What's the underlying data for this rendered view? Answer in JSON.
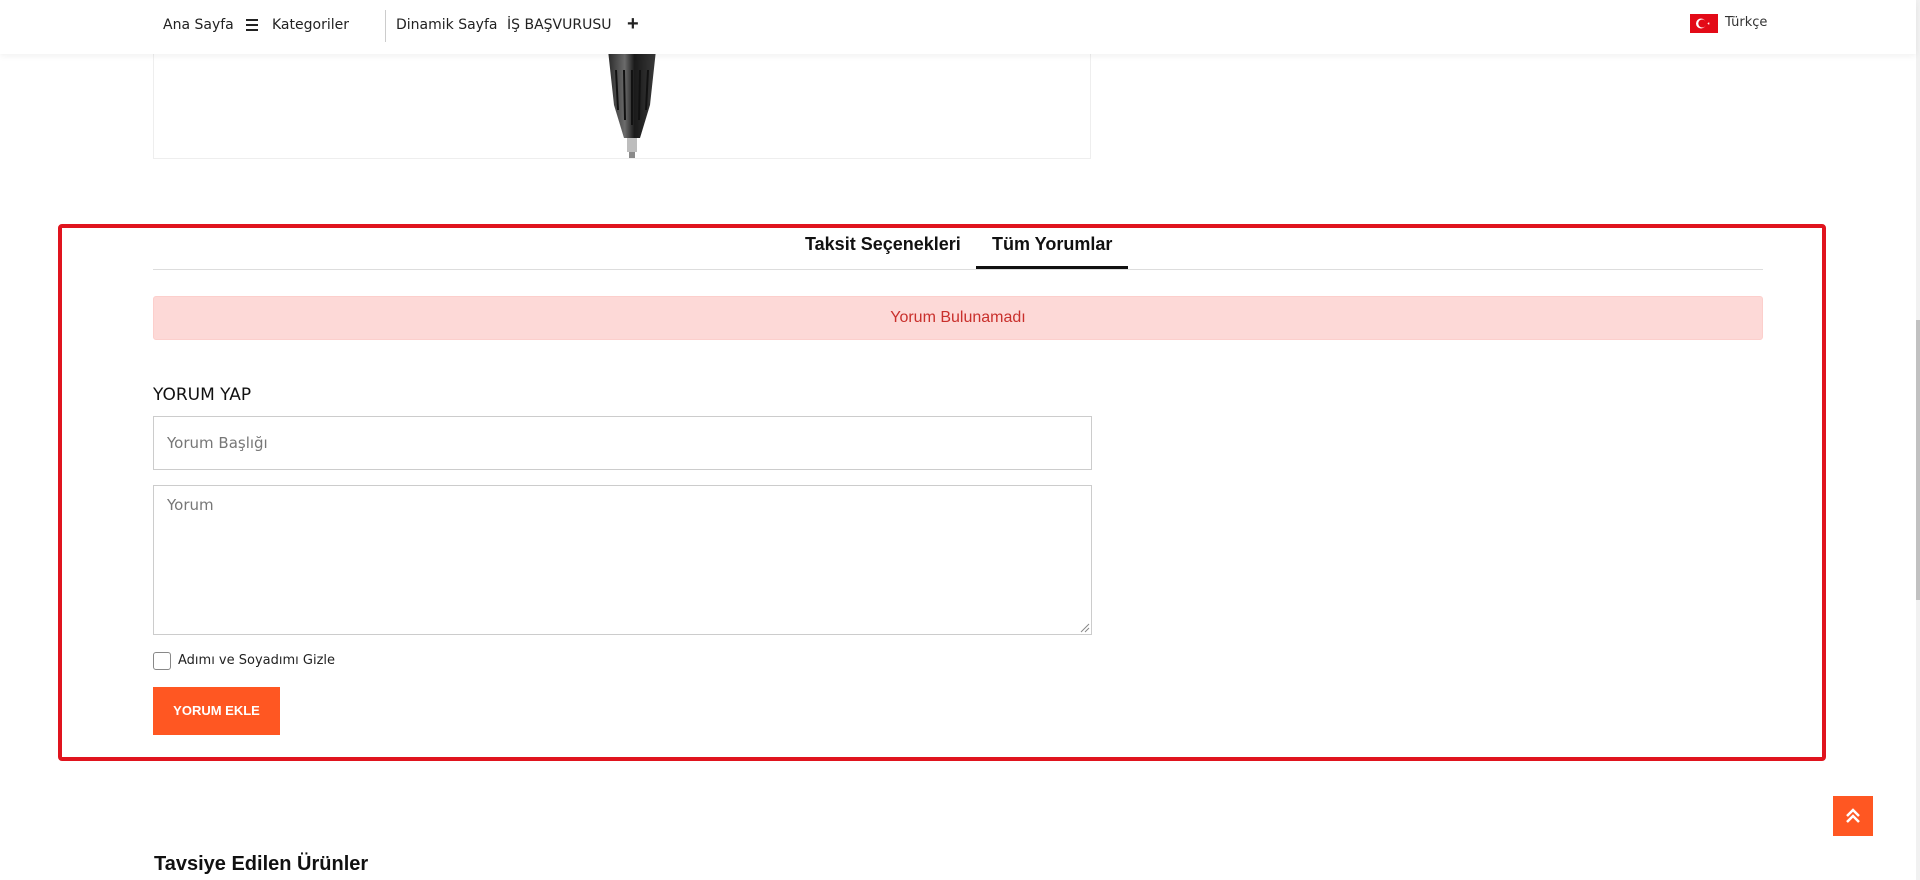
{
  "nav": {
    "home": "Ana Sayfa",
    "categories": "Kategoriler",
    "dynamic_page": "Dinamik Sayfa",
    "job_application": "İŞ BAŞVURUSU",
    "language": "Türkçe"
  },
  "tabs": [
    {
      "label": "Taksit Seçenekleri",
      "active": false
    },
    {
      "label": "Tüm Yorumlar",
      "active": true
    }
  ],
  "alert": {
    "text": "Yorum Bulunamadı"
  },
  "review_form": {
    "title": "YORUM YAP",
    "title_placeholder": "Yorum Başlığı",
    "title_value": "",
    "comment_placeholder": "Yorum",
    "comment_value": "",
    "hide_name_label": "Adımı ve Soyadımı Gizle",
    "hide_name_checked": false,
    "submit_label": "YORUM EKLE"
  },
  "recommended": {
    "title": "Tavsiye Edilen Ürünler"
  },
  "colors": {
    "accent": "#ff5722",
    "highlight": "#e0141e",
    "alert_bg": "#fdd9d7",
    "alert_text": "#c9302c"
  }
}
